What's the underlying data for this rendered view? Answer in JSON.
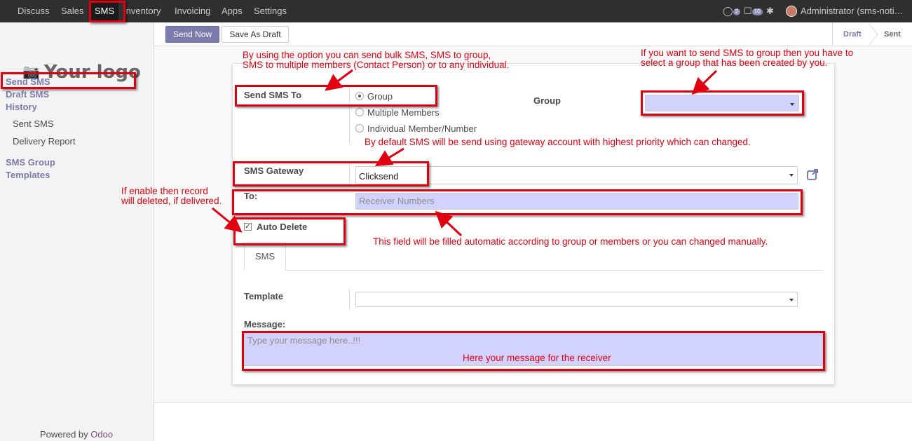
{
  "topbar": {
    "menu": [
      "Discuss",
      "Sales",
      "SMS",
      "Inventory",
      "Invoicing",
      "Apps",
      "Settings"
    ],
    "active": "SMS",
    "chat_badge": "2",
    "msg_badge": "10",
    "user": "Administrator (sms-noti…"
  },
  "sidebar": {
    "logo_text": "Your logo",
    "items": [
      "Send SMS",
      "Draft SMS",
      "History",
      "Sent SMS",
      "Delivery Report",
      "SMS Group",
      "Templates"
    ],
    "powered_prefix": "Powered by",
    "powered_brand": "Odoo"
  },
  "controls": {
    "send_now": "Send Now",
    "save_draft": "Save As Draft",
    "status_draft": "Draft",
    "status_sent": "Sent"
  },
  "form": {
    "send_sms_to_label": "Send SMS To",
    "options": [
      "Group",
      "Multiple Members",
      "Individual Member/Number"
    ],
    "selected_option": "Group",
    "group_label": "Group",
    "group_value": "",
    "gateway_label": "SMS Gateway",
    "gateway_value": "Clicksend",
    "to_label": "To:",
    "to_placeholder": "Receiver Numbers",
    "auto_delete_label": "Auto Delete",
    "auto_delete_checked": true,
    "tab_label": "SMS",
    "template_label": "Template",
    "template_value": "",
    "message_label": "Message:",
    "message_placeholder": "Type your message here..!!!"
  },
  "annotations": {
    "a1": "By using the option you can send bulk SMS, SMS to group,",
    "a1b": "SMS to multiple members (Contact Person) or to any individual.",
    "a2": "If you want to send SMS to group then you have to",
    "a2b": "select a group that has been created by you.",
    "a3": "By default SMS will be send using gateway account with highest priority which can changed.",
    "a4": "If enable then record",
    "a4b": "will deleted, if delivered.",
    "a5": "This field will be filled automatic according to group or members or you can changed manually.",
    "a6": "Here your message for the receiver"
  },
  "colors": {
    "accent": "#7c7bad",
    "annotation": "#e00010",
    "highlight_field": "#d2d2ff",
    "topbar": "#2f2f2f"
  }
}
